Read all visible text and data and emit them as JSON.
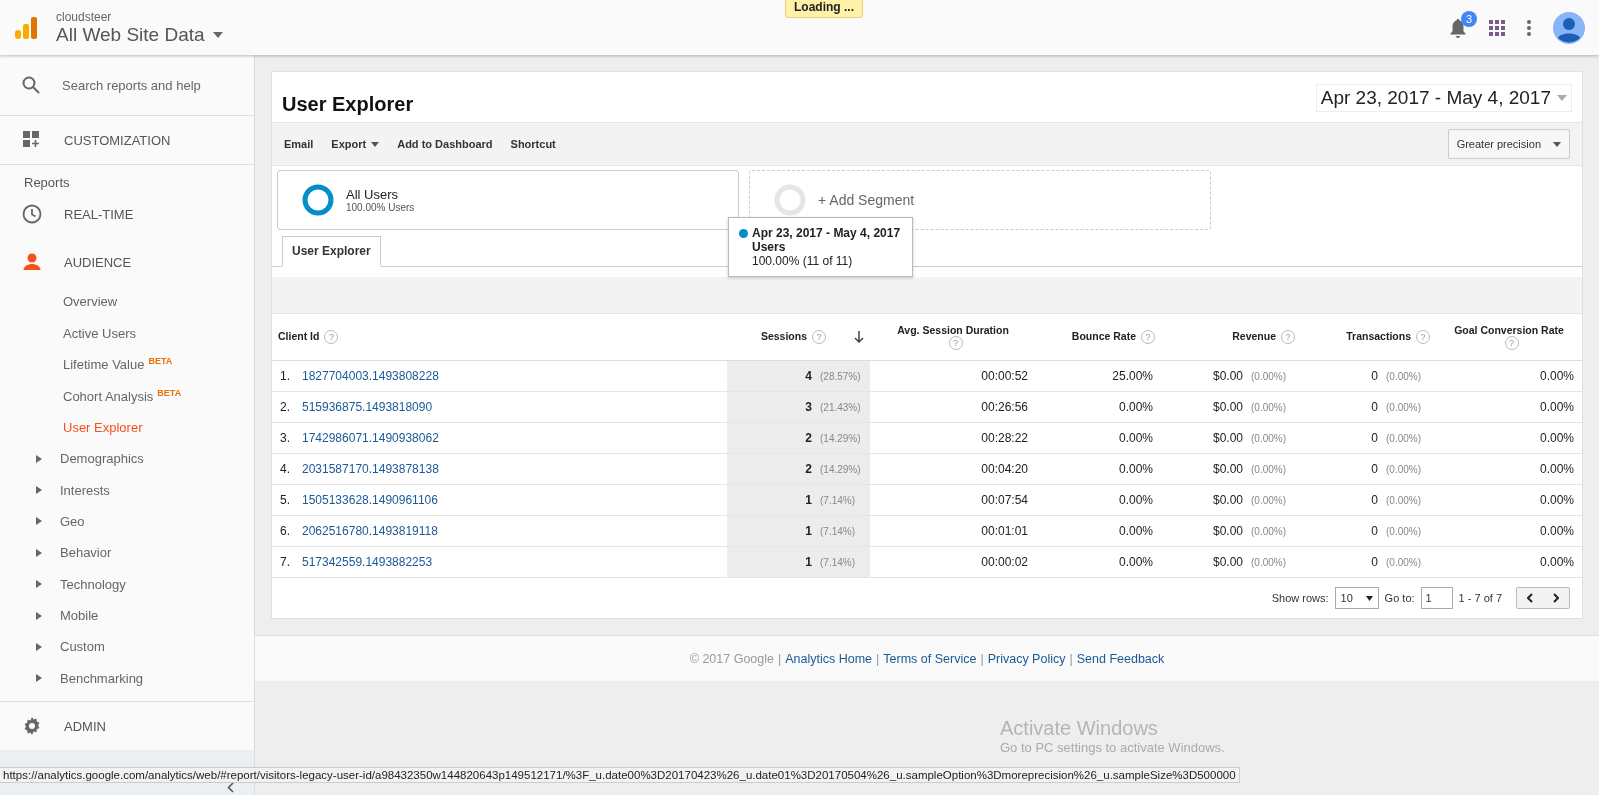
{
  "header": {
    "account": "cloudsteer",
    "property": "All Web Site Data",
    "loading": "Loading ...",
    "notification_count": "3"
  },
  "sidebar": {
    "search_placeholder": "Search reports and help",
    "items": [
      {
        "kind": "section",
        "label": "CUSTOMIZATION",
        "selected": false
      },
      {
        "kind": "heading",
        "label": "Reports"
      },
      {
        "kind": "section",
        "label": "REAL-TIME",
        "selected": false
      },
      {
        "kind": "section",
        "label": "AUDIENCE",
        "selected": true,
        "children": [
          {
            "kind": "link",
            "label": "Overview",
            "selected": false
          },
          {
            "kind": "link",
            "label": "Active Users",
            "selected": false
          },
          {
            "kind": "link",
            "label": "Lifetime Value",
            "badge": "BETA",
            "selected": false
          },
          {
            "kind": "link",
            "label": "Cohort Analysis",
            "badge": "BETA",
            "selected": false
          },
          {
            "kind": "link",
            "label": "User Explorer",
            "selected": true
          },
          {
            "kind": "group",
            "label": "Demographics",
            "selected": false
          },
          {
            "kind": "group",
            "label": "Interests",
            "selected": false
          },
          {
            "kind": "group",
            "label": "Geo",
            "selected": false
          },
          {
            "kind": "group",
            "label": "Behavior",
            "selected": false
          },
          {
            "kind": "group",
            "label": "Technology",
            "selected": false
          },
          {
            "kind": "group",
            "label": "Mobile",
            "selected": false
          },
          {
            "kind": "group",
            "label": "Custom",
            "selected": false
          },
          {
            "kind": "group",
            "label": "Benchmarking",
            "selected": false
          }
        ]
      }
    ],
    "admin": {
      "label": "ADMIN"
    }
  },
  "report": {
    "title": "User Explorer",
    "date_range": "Apr 23, 2017 - May 4, 2017",
    "toolbar": [
      {
        "label": "Email",
        "dropdown": false
      },
      {
        "label": "Export",
        "dropdown": true
      },
      {
        "label": "Add to Dashboard",
        "dropdown": false
      },
      {
        "label": "Shortcut",
        "dropdown": false
      }
    ],
    "precision": "Greater precision",
    "segments": [
      {
        "kind": "active",
        "name": "All Users",
        "detail": "100.00% Users"
      },
      {
        "kind": "add",
        "name": "+ Add Segment"
      }
    ],
    "tooltip": {
      "title": "Apr 23, 2017 - May 4, 2017",
      "metric": "Users",
      "value": "100.00% (11 of 11)",
      "color": "#058dc7"
    },
    "tabs": [
      {
        "label": "User Explorer",
        "selected": true
      }
    ],
    "table": {
      "columns": [
        {
          "label": "Client Id",
          "help": "?",
          "sorted": false
        },
        {
          "label": "Sessions",
          "help": "?",
          "sorted": true
        },
        {
          "label": "Avg. Session Duration",
          "help": "?",
          "sorted": false
        },
        {
          "label": "Bounce Rate",
          "help": "?",
          "sorted": false
        },
        {
          "label": "Revenue",
          "help": "?",
          "sorted": false
        },
        {
          "label": "Transactions",
          "help": "?",
          "sorted": false
        },
        {
          "label": "Goal Conversion Rate",
          "help": "?",
          "sorted": false
        }
      ],
      "rows": [
        {
          "index": "1.",
          "client_id": "1827704003.1493808228",
          "sessions": "4",
          "sessions_pct": "(28.57%)",
          "duration": "00:00:52",
          "bounce": "25.00%",
          "revenue": "$0.00",
          "revenue_pct": "(0.00%)",
          "transactions": "0",
          "transactions_pct": "(0.00%)",
          "goal": "0.00%"
        },
        {
          "index": "2.",
          "client_id": "515936875.1493818090",
          "sessions": "3",
          "sessions_pct": "(21.43%)",
          "duration": "00:26:56",
          "bounce": "0.00%",
          "revenue": "$0.00",
          "revenue_pct": "(0.00%)",
          "transactions": "0",
          "transactions_pct": "(0.00%)",
          "goal": "0.00%"
        },
        {
          "index": "3.",
          "client_id": "1742986071.1490938062",
          "sessions": "2",
          "sessions_pct": "(14.29%)",
          "duration": "00:28:22",
          "bounce": "0.00%",
          "revenue": "$0.00",
          "revenue_pct": "(0.00%)",
          "transactions": "0",
          "transactions_pct": "(0.00%)",
          "goal": "0.00%"
        },
        {
          "index": "4.",
          "client_id": "2031587170.1493878138",
          "sessions": "2",
          "sessions_pct": "(14.29%)",
          "duration": "00:04:20",
          "bounce": "0.00%",
          "revenue": "$0.00",
          "revenue_pct": "(0.00%)",
          "transactions": "0",
          "transactions_pct": "(0.00%)",
          "goal": "0.00%"
        },
        {
          "index": "5.",
          "client_id": "1505133628.1490961106",
          "sessions": "1",
          "sessions_pct": "(7.14%)",
          "duration": "00:07:54",
          "bounce": "0.00%",
          "revenue": "$0.00",
          "revenue_pct": "(0.00%)",
          "transactions": "0",
          "transactions_pct": "(0.00%)",
          "goal": "0.00%"
        },
        {
          "index": "6.",
          "client_id": "2062516780.1493819118",
          "sessions": "1",
          "sessions_pct": "(7.14%)",
          "duration": "00:01:01",
          "bounce": "0.00%",
          "revenue": "$0.00",
          "revenue_pct": "(0.00%)",
          "transactions": "0",
          "transactions_pct": "(0.00%)",
          "goal": "0.00%"
        },
        {
          "index": "7.",
          "client_id": "517342559.1493882253",
          "sessions": "1",
          "sessions_pct": "(7.14%)",
          "duration": "00:00:02",
          "bounce": "0.00%",
          "revenue": "$0.00",
          "revenue_pct": "(0.00%)",
          "transactions": "0",
          "transactions_pct": "(0.00%)",
          "goal": "0.00%"
        }
      ]
    },
    "pagination": {
      "show_rows_label": "Show rows:",
      "rows_value": "10",
      "goto_label": "Go to:",
      "page": "1",
      "range": "1 - 7 of 7"
    }
  },
  "footer": {
    "copyright": "© 2017 Google",
    "separator": "|",
    "links": [
      "Analytics Home",
      "Terms of Service",
      "Privacy Policy",
      "Send Feedback"
    ]
  },
  "status_url": "https://analytics.google.com/analytics/web/#report/visitors-legacy-user-id/a98432350w144820643p149512171/%3F_u.date00%3D20170423%26_u.date01%3D20170504%26_u.sampleOption%3Dmoreprecision%26_u.sampleSize%3D500000",
  "os_overlay": {
    "title": "Activate Windows",
    "detail": "Go to PC settings to activate Windows."
  }
}
